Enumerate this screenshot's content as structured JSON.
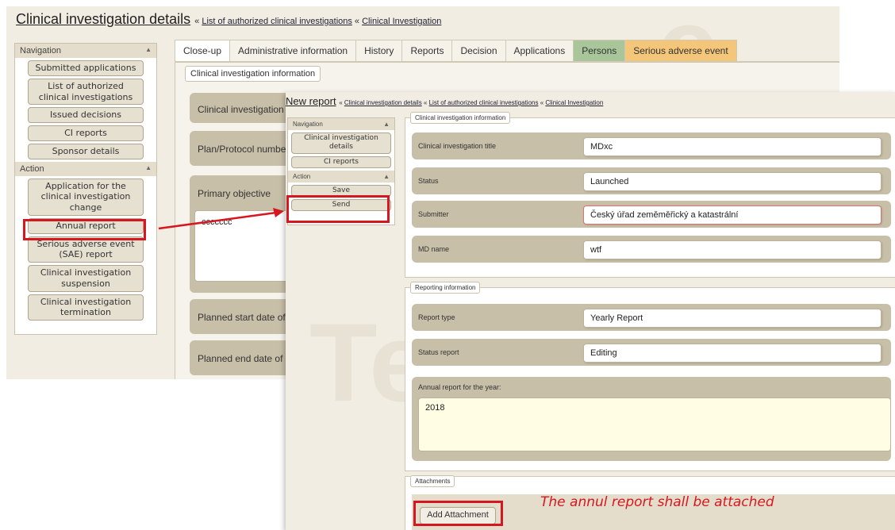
{
  "background_window": {
    "title": "Clinical investigation details",
    "breadcrumb": [
      "List of authorized clinical investigations",
      "Clinical Investigation"
    ],
    "sidebar": {
      "navigation_label": "Navigation",
      "navigation_items": [
        "Submitted applications",
        "List of authorized clinical investigations",
        "Issued decisions",
        "CI reports",
        "Sponsor details"
      ],
      "action_label": "Action",
      "action_items": [
        "Application for the clinical investigation change",
        "Annual report",
        "Serious adverse event (SAE) report",
        "Clinical investigation suspension",
        "Clinical investigation termination"
      ]
    },
    "tabs": [
      "Close-up",
      "Administrative information",
      "History",
      "Reports",
      "Decision",
      "Applications",
      "Persons",
      "Serious adverse event"
    ],
    "section_label": "Clinical investigation information",
    "rows": [
      "Clinical investigation",
      "Plan/Protocol numbe",
      "Primary objective",
      "Planned start date of",
      "Planned end date of"
    ],
    "primary_objective_value": "ccccccc"
  },
  "foreground_window": {
    "title": "New report",
    "breadcrumb": [
      "Clinical investigation details",
      "List of authorized clinical investigations",
      "Clinical Investigation"
    ],
    "sidebar": {
      "navigation_label": "Navigation",
      "navigation_items": [
        "Clinical investigation details",
        "CI reports"
      ],
      "action_label": "Action",
      "action_items": [
        "Save",
        "Send"
      ]
    },
    "ci_section_label": "Clinical investigation information",
    "ci_fields": [
      {
        "label": "Clinical investigation title",
        "value": "MDxc"
      },
      {
        "label": "Status",
        "value": "Launched"
      },
      {
        "label": "Submitter",
        "value": "Český úřad zeměměřický a katastrální"
      },
      {
        "label": "MD name",
        "value": "wtf"
      }
    ],
    "reporting_section_label": "Reporting information",
    "reporting_fields": [
      {
        "label": "Report type",
        "value": "Yearly Report"
      },
      {
        "label": "Status report",
        "value": "Editing"
      }
    ],
    "annual_label": "Annual report for the year:",
    "annual_value": "2018",
    "attachments_label": "Attachments",
    "add_attachment": "Add Attachment"
  },
  "annotation": {
    "note": "The annul report shall be attached",
    "highlight_color": "#d7171f"
  }
}
